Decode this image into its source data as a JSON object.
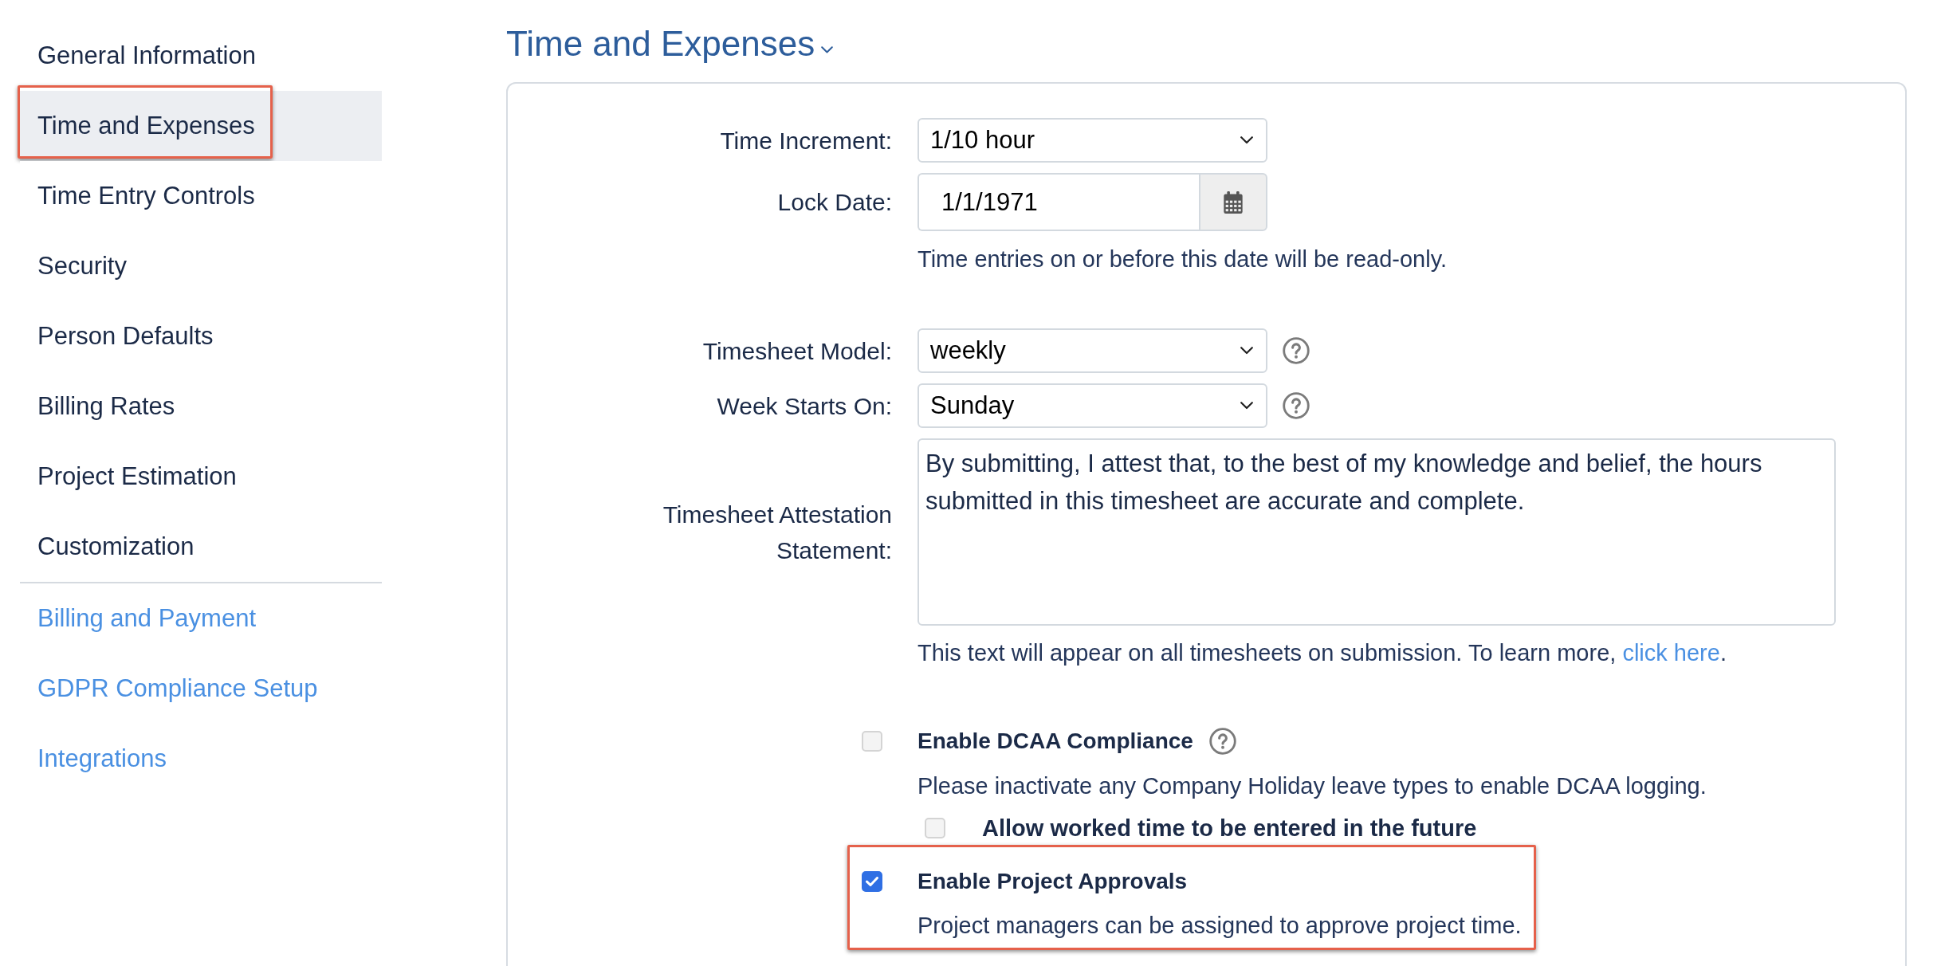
{
  "sidebar": {
    "items": [
      {
        "label": "General Information",
        "selected": false,
        "highlighted": false
      },
      {
        "label": "Time and Expenses",
        "selected": true,
        "highlighted": true
      },
      {
        "label": "Time Entry Controls",
        "selected": false,
        "highlighted": false
      },
      {
        "label": "Security",
        "selected": false,
        "highlighted": false
      },
      {
        "label": "Person Defaults",
        "selected": false,
        "highlighted": false
      },
      {
        "label": "Billing Rates",
        "selected": false,
        "highlighted": false
      },
      {
        "label": "Project Estimation",
        "selected": false,
        "highlighted": false
      },
      {
        "label": "Customization",
        "selected": false,
        "highlighted": false
      }
    ],
    "links": [
      {
        "label": "Billing and Payment"
      },
      {
        "label": "GDPR Compliance Setup"
      },
      {
        "label": "Integrations"
      }
    ]
  },
  "page": {
    "title": "Time and Expenses"
  },
  "form": {
    "sections": [
      {
        "fields": [
          {
            "kind": "select",
            "label": "Time Increment:",
            "value": "1/10 hour",
            "help": false
          },
          {
            "kind": "date",
            "label": "Lock Date:",
            "value": "1/1/1971",
            "help": false,
            "hint": {
              "text": "Time entries on or before this date will be read-only."
            }
          }
        ]
      },
      {
        "fields": [
          {
            "kind": "select",
            "label": "Timesheet Model:",
            "value": "weekly",
            "help": true
          },
          {
            "kind": "select",
            "label": "Week Starts On:",
            "value": "Sunday",
            "help": true
          },
          {
            "kind": "textarea",
            "label": "Timesheet Attestation Statement:",
            "value": "By submitting, I attest that, to the best of my knowledge and belief, the hours submitted in this timesheet are accurate and complete.",
            "help": false,
            "hint": {
              "text": "This text will appear on all timesheets on submission. To learn more,",
              "link": "click here",
              "after": "."
            }
          }
        ]
      }
    ]
  },
  "options": [
    {
      "label": "Enable DCAA Compliance",
      "checked": false,
      "help": true,
      "highlighted": false,
      "note": "Please inactivate any Company Holiday leave types to enable DCAA logging.",
      "children": [
        {
          "label": "Allow worked time to be entered in the future",
          "checked": false
        }
      ]
    },
    {
      "label": "Enable Project Approvals",
      "checked": true,
      "help": false,
      "highlighted": true,
      "note": "Project managers can be assigned to approve project time."
    }
  ]
}
